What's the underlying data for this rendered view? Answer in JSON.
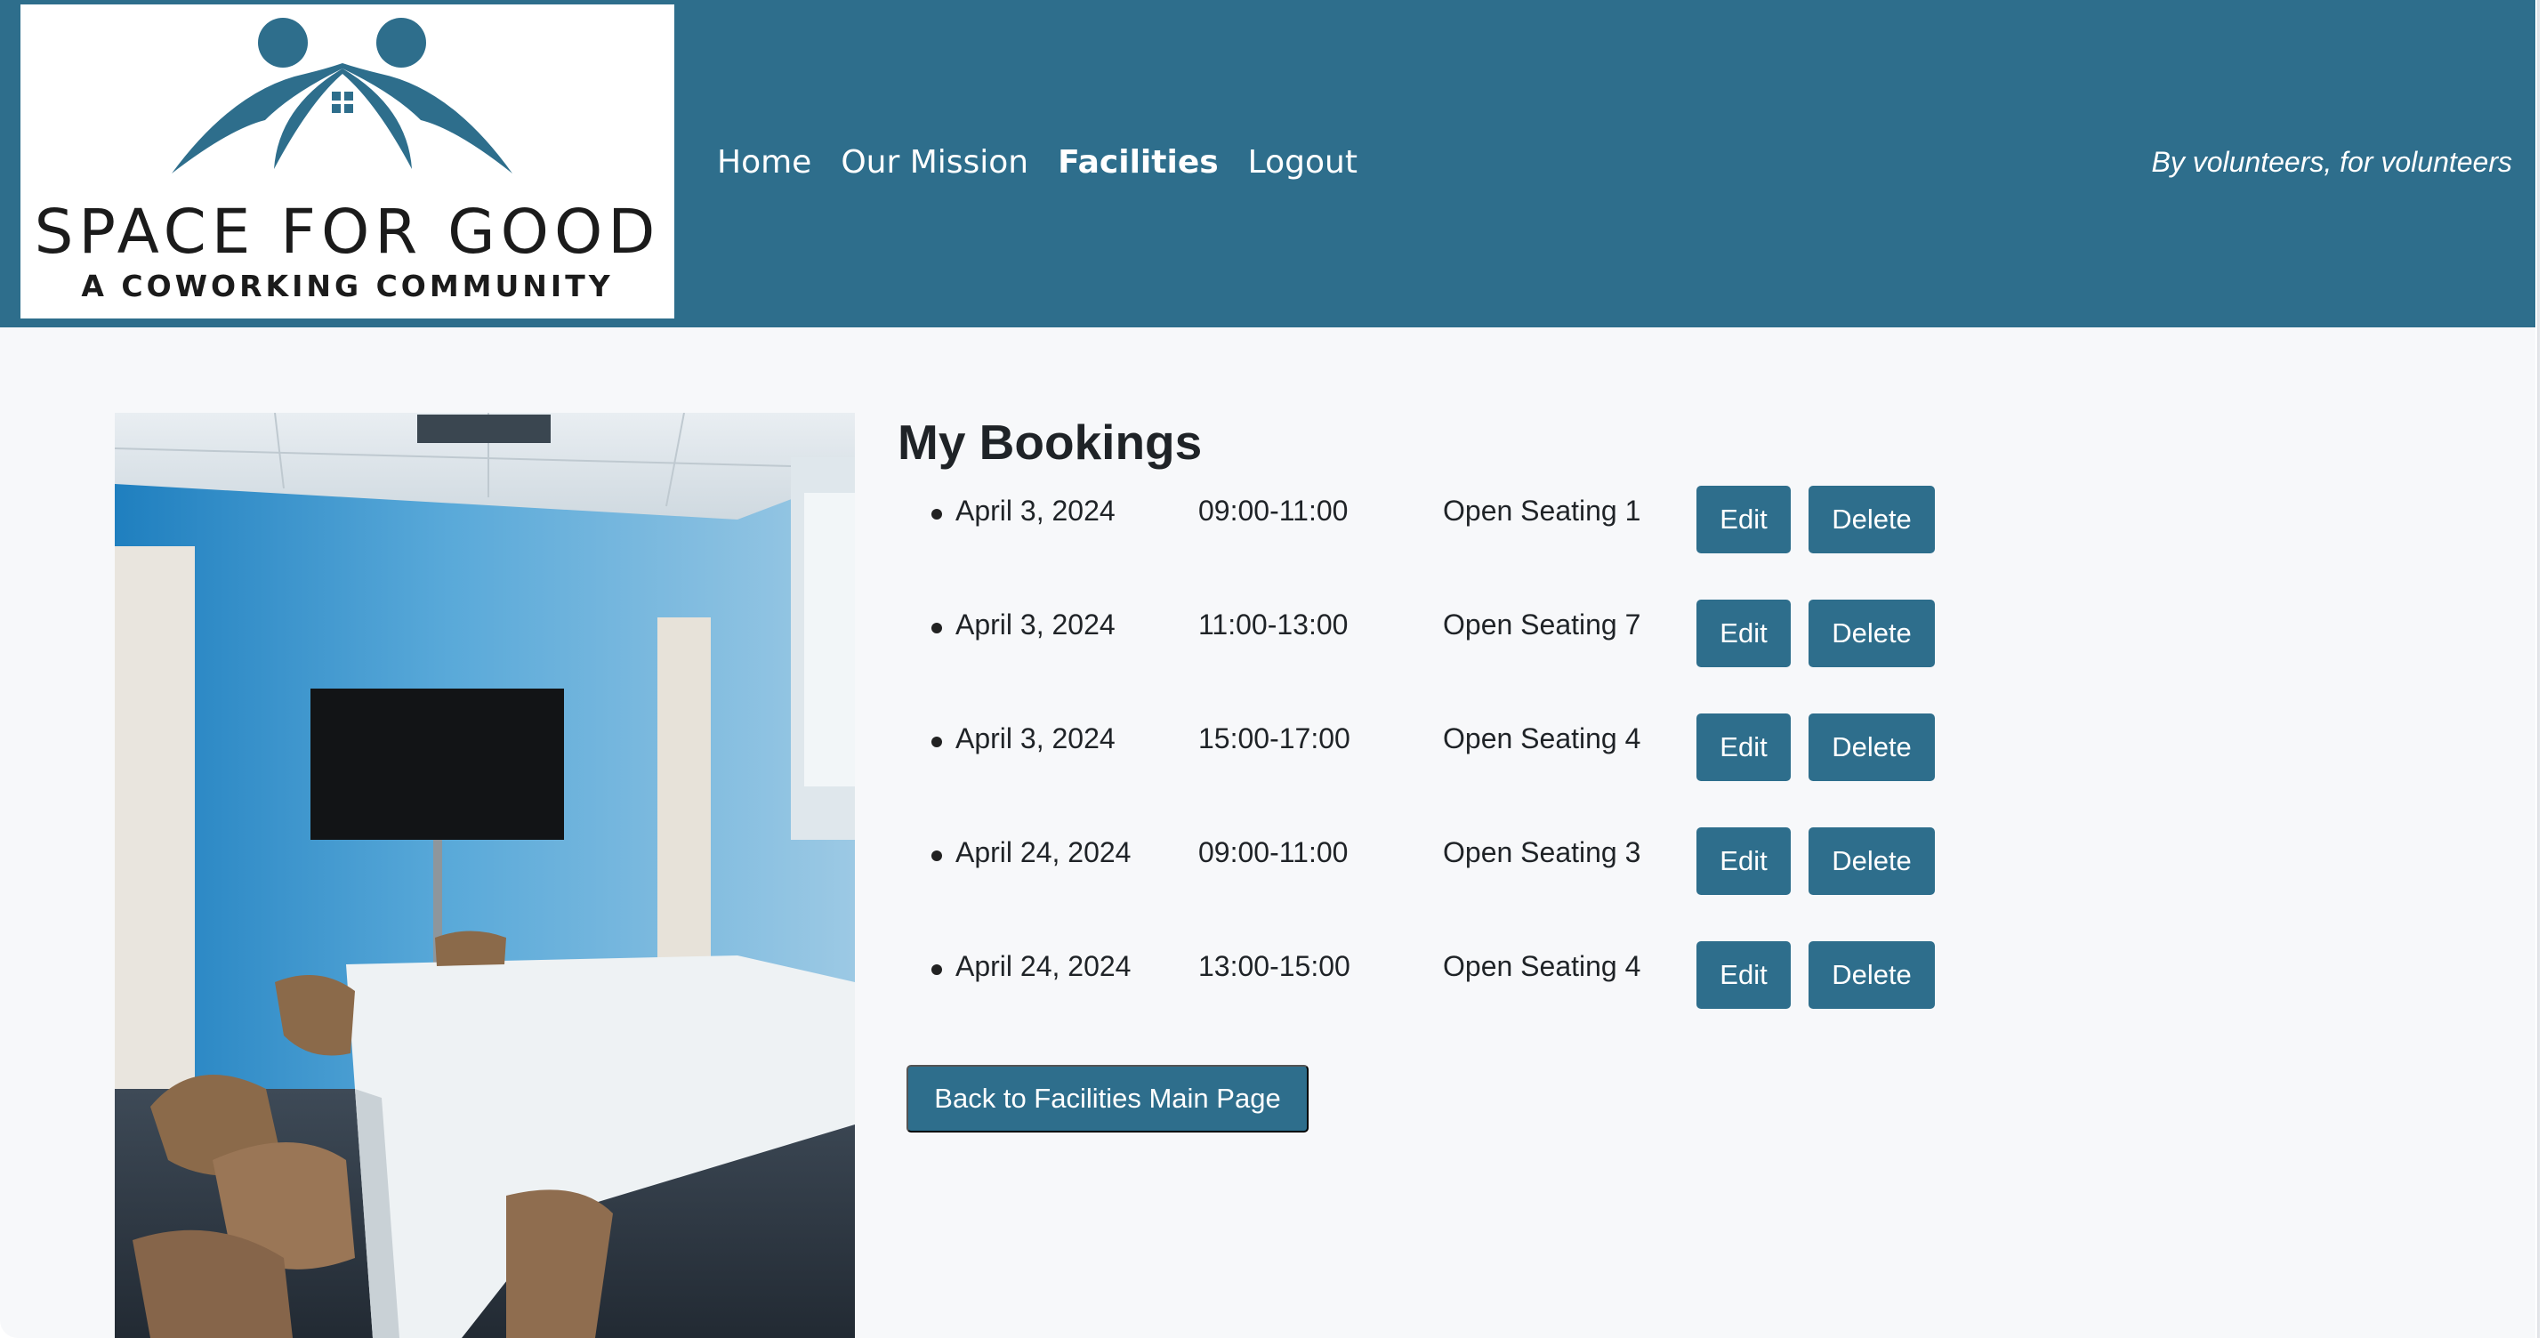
{
  "brand": {
    "logo_title": "SPACE FOR GOOD",
    "logo_subtitle": "A COWORKING COMMUNITY",
    "logo_icon": "two-people-house-icon",
    "color": "#2e6e8c"
  },
  "nav": {
    "items": [
      {
        "label": "Home"
      },
      {
        "label": "Our Mission"
      },
      {
        "label": "Facilities",
        "active": true
      },
      {
        "label": "Logout"
      }
    ]
  },
  "tagline": "By volunteers, for volunteers",
  "page": {
    "title": "My Bookings",
    "photo": "meeting-room-photo"
  },
  "bookings": [
    {
      "date": "April 3, 2024",
      "time": "09:00-11:00",
      "room": "Open Seating 1"
    },
    {
      "date": "April 3, 2024",
      "time": "11:00-13:00",
      "room": "Open Seating 7"
    },
    {
      "date": "April 3, 2024",
      "time": "15:00-17:00",
      "room": "Open Seating 4"
    },
    {
      "date": "April 24, 2024",
      "time": "09:00-11:00",
      "room": "Open Seating 3"
    },
    {
      "date": "April 24, 2024",
      "time": "13:00-15:00",
      "room": "Open Seating 4"
    }
  ],
  "actions": {
    "edit_label": "Edit",
    "delete_label": "Delete",
    "back_label": "Back to Facilities Main Page"
  }
}
